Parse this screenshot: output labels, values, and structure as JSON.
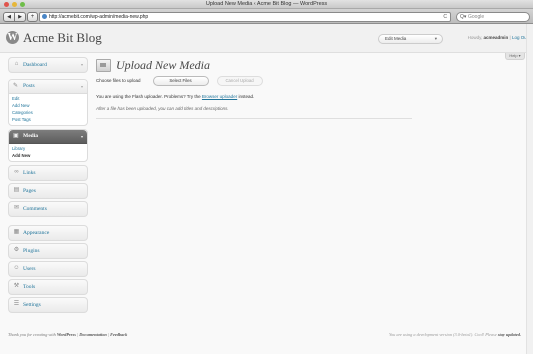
{
  "window": {
    "title": "Upload New Media ‹ Acme Bit Blog — WordPress"
  },
  "browser": {
    "back": "◀",
    "forward": "▶",
    "add": "+",
    "url": "http://acmebit.com/wp-admin/media-new.php",
    "reload": "C",
    "search_engine": "Q▾",
    "search_placeholder": "Google"
  },
  "header": {
    "logo": "W",
    "blog_name": "Acme Bit Blog",
    "favorite_label": "Edit Media",
    "favorite_arrow": "▾",
    "howdy": "Howdy,",
    "username": "acmeadmin",
    "separator": "|",
    "logout": "Log Out",
    "help": "Help ▾"
  },
  "sidebar": {
    "dashboard": {
      "icon": "⌂",
      "label": "Dashboard",
      "arrow": "▾"
    },
    "posts": {
      "icon": "✎",
      "label": "Posts",
      "arrow": "▾",
      "items": [
        "Edit",
        "Add New",
        "Categories",
        "Post Tags"
      ]
    },
    "media": {
      "icon": "▣",
      "label": "Media",
      "arrow": "▾",
      "items": [
        "Library",
        "Add New"
      ]
    },
    "links": {
      "icon": "∞",
      "label": "Links"
    },
    "pages": {
      "icon": "▤",
      "label": "Pages"
    },
    "comments": {
      "icon": "✉",
      "label": "Comments"
    },
    "appearance": {
      "icon": "▦",
      "label": "Appearance"
    },
    "plugins": {
      "icon": "⚙",
      "label": "Plugins"
    },
    "users": {
      "icon": "☺",
      "label": "Users"
    },
    "tools": {
      "icon": "⚒",
      "label": "Tools"
    },
    "settings": {
      "icon": "☰",
      "label": "Settings"
    }
  },
  "main": {
    "title": "Upload New Media",
    "choose_label": "Choose files to upload",
    "select_button": "Select Files",
    "cancel_button": "Cancel Upload",
    "flash_note_pre": "You are using the Flash uploader. Problems? Try the",
    "flash_note_link": "Browser uploader",
    "flash_note_post": "instead.",
    "after_note": "After a file has been uploaded, you can add titles and descriptions."
  },
  "footer": {
    "thanks_pre": "Thank you for creating with",
    "wordpress": "WordPress",
    "sep1": "|",
    "documentation": "Documentation",
    "sep2": "|",
    "feedback": "Feedback",
    "version_note": "You are using a development version (3.0-beta1). Cool! Please",
    "stay_updated": "stay updated."
  }
}
